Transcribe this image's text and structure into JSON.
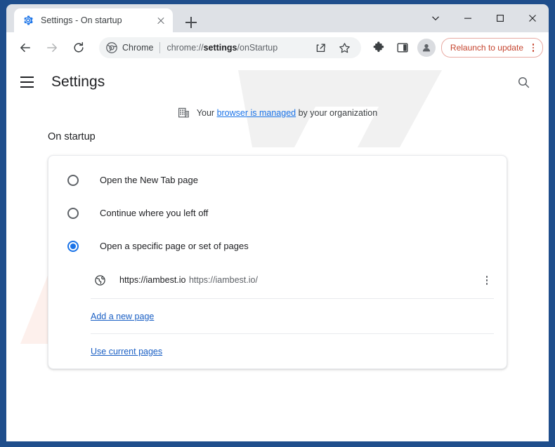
{
  "window": {
    "frame_color": "#1f4e8c",
    "controls": [
      {
        "name": "tab-search-chevron",
        "icon": "chevron-down-icon"
      },
      {
        "name": "minimize",
        "icon": "minimize-icon"
      },
      {
        "name": "maximize",
        "icon": "maximize-icon"
      },
      {
        "name": "close",
        "icon": "close-icon"
      }
    ]
  },
  "tabstrip": {
    "tab": {
      "favicon": "settings-gear-icon",
      "title": "Settings - On startup",
      "close_label": "Close tab"
    },
    "new_tab_label": "New tab"
  },
  "toolbar": {
    "back_label": "Back",
    "forward_label": "Forward",
    "reload_label": "Reload",
    "omnibox": {
      "badge_label": "Chrome",
      "badge_icon": "chrome-logo-icon",
      "url_prefix": "chrome://",
      "url_bold": "settings",
      "url_suffix": "/onStartup",
      "url_full": "chrome://settings/onStartup"
    },
    "actions": [
      {
        "name": "share-icon",
        "label": "Share this page"
      },
      {
        "name": "bookmark-star-icon",
        "label": "Bookmark this tab"
      }
    ],
    "icons": [
      {
        "name": "extensions-puzzle-icon",
        "label": "Extensions"
      },
      {
        "name": "side-panel-icon",
        "label": "Side panel"
      }
    ],
    "avatar_label": "Profile",
    "relaunch": {
      "label": "Relaunch to update",
      "color": "#c5442e",
      "border_color": "#e8aaa3"
    },
    "menu_label": "Customize and control Google Chrome"
  },
  "settings": {
    "menu_label": "Main menu",
    "title": "Settings",
    "search_label": "Search settings",
    "managed": {
      "icon": "enterprise-building-icon",
      "prefix": "Your ",
      "link": "browser is managed",
      "suffix": " by your organization"
    },
    "section_title": "On startup",
    "options": [
      {
        "label": "Open the New Tab page",
        "checked": false
      },
      {
        "label": "Continue where you left off",
        "checked": false
      },
      {
        "label": "Open a specific page or set of pages",
        "checked": true
      }
    ],
    "startup_pages": [
      {
        "icon": "globe-icon",
        "title": "https://iambest.io",
        "url": "https://iambest.io/",
        "menu_label": "More actions"
      }
    ],
    "add_page_link": "Add a new page",
    "use_current_link": "Use current pages",
    "accent_color": "#1a73e8",
    "link_color": "#1a5fc4"
  },
  "watermark": {
    "text_top": "PC",
    "text_bottom": "risk.com"
  }
}
